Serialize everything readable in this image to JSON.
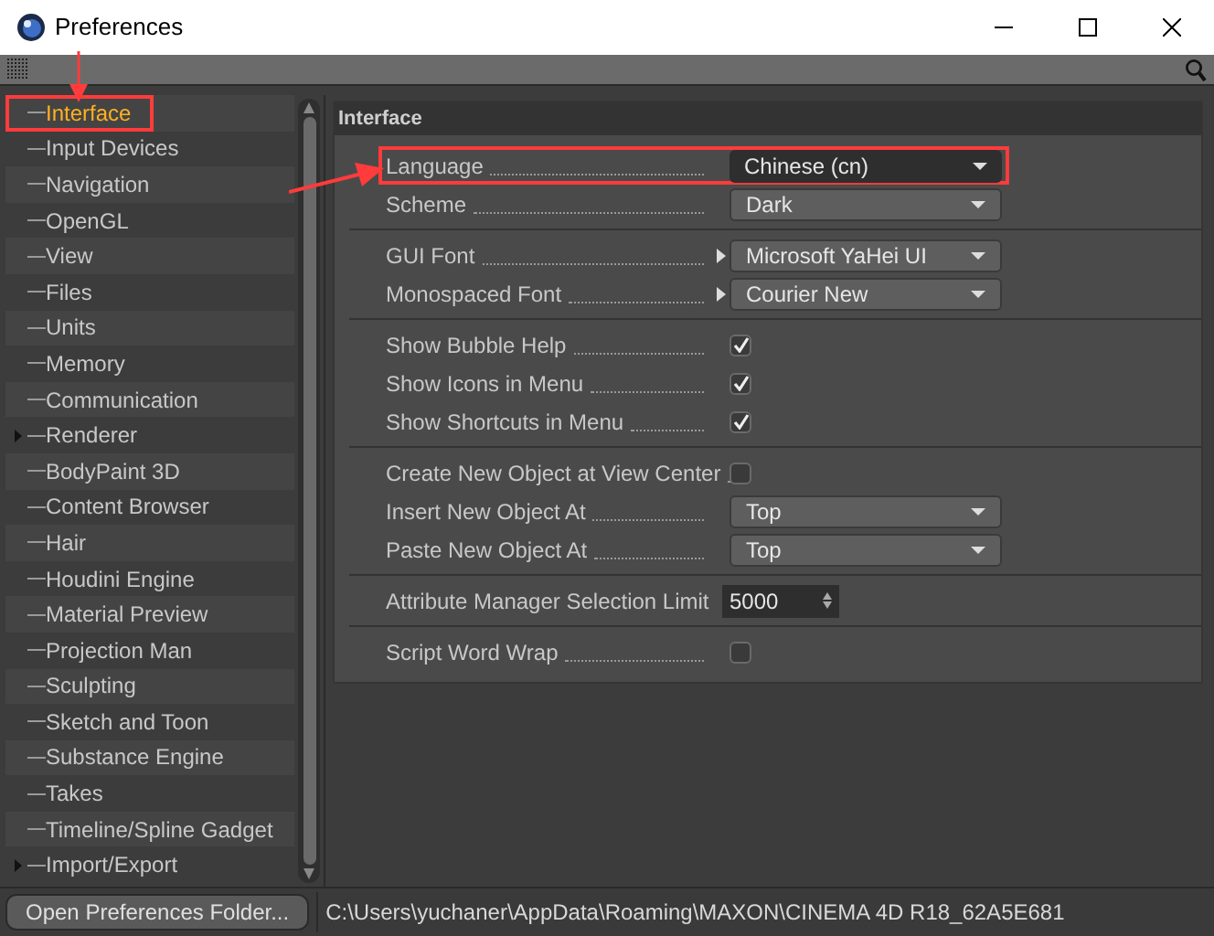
{
  "window": {
    "title": "Preferences"
  },
  "sidebar": {
    "items": [
      {
        "label": "Interface",
        "selected": true,
        "expandable": false
      },
      {
        "label": "Input Devices",
        "selected": false,
        "expandable": false
      },
      {
        "label": "Navigation",
        "selected": false,
        "expandable": false
      },
      {
        "label": "OpenGL",
        "selected": false,
        "expandable": false
      },
      {
        "label": "View",
        "selected": false,
        "expandable": false
      },
      {
        "label": "Files",
        "selected": false,
        "expandable": false
      },
      {
        "label": "Units",
        "selected": false,
        "expandable": false
      },
      {
        "label": "Memory",
        "selected": false,
        "expandable": false
      },
      {
        "label": "Communication",
        "selected": false,
        "expandable": false
      },
      {
        "label": "Renderer",
        "selected": false,
        "expandable": true
      },
      {
        "label": "BodyPaint 3D",
        "selected": false,
        "expandable": false
      },
      {
        "label": "Content Browser",
        "selected": false,
        "expandable": false
      },
      {
        "label": "Hair",
        "selected": false,
        "expandable": false
      },
      {
        "label": "Houdini Engine",
        "selected": false,
        "expandable": false
      },
      {
        "label": "Material Preview",
        "selected": false,
        "expandable": false
      },
      {
        "label": "Projection Man",
        "selected": false,
        "expandable": false
      },
      {
        "label": "Sculpting",
        "selected": false,
        "expandable": false
      },
      {
        "label": "Sketch and Toon",
        "selected": false,
        "expandable": false
      },
      {
        "label": "Substance Engine",
        "selected": false,
        "expandable": false
      },
      {
        "label": "Takes",
        "selected": false,
        "expandable": false
      },
      {
        "label": "Timeline/Spline Gadget",
        "selected": false,
        "expandable": false
      },
      {
        "label": "Import/Export",
        "selected": false,
        "expandable": true
      }
    ]
  },
  "panel": {
    "title": "Interface",
    "groups": [
      [
        {
          "kind": "dropdown",
          "label": "Language",
          "value": "Chinese (cn)",
          "has_menu": false,
          "highlighted": true
        },
        {
          "kind": "dropdown",
          "label": "Scheme",
          "value": "Dark",
          "has_menu": false,
          "highlighted": false
        }
      ],
      [
        {
          "kind": "dropdown",
          "label": "GUI Font",
          "value": "Microsoft YaHei UI",
          "has_menu": true,
          "highlighted": false
        },
        {
          "kind": "dropdown",
          "label": "Monospaced Font",
          "value": "Courier New",
          "has_menu": true,
          "highlighted": false
        }
      ],
      [
        {
          "kind": "checkbox",
          "label": "Show Bubble Help",
          "checked": true
        },
        {
          "kind": "checkbox",
          "label": "Show Icons in Menu",
          "checked": true
        },
        {
          "kind": "checkbox",
          "label": "Show Shortcuts in Menu",
          "checked": true
        }
      ],
      [
        {
          "kind": "checkbox",
          "label": "Create New Object at View Center",
          "checked": false
        },
        {
          "kind": "dropdown",
          "label": "Insert New Object At",
          "value": "Top",
          "has_menu": false,
          "highlighted": false
        },
        {
          "kind": "dropdown",
          "label": "Paste New Object At",
          "value": "Top",
          "has_menu": false,
          "highlighted": false
        }
      ],
      [
        {
          "kind": "number",
          "label": "Attribute Manager Selection Limit",
          "value": "5000"
        }
      ],
      [
        {
          "kind": "checkbox",
          "label": "Script Word Wrap",
          "checked": false
        }
      ]
    ]
  },
  "footer": {
    "button": "Open Preferences Folder...",
    "path": "C:\\Users\\yuchaner\\AppData\\Roaming\\MAXON\\CINEMA 4D R18_62A5E681"
  }
}
